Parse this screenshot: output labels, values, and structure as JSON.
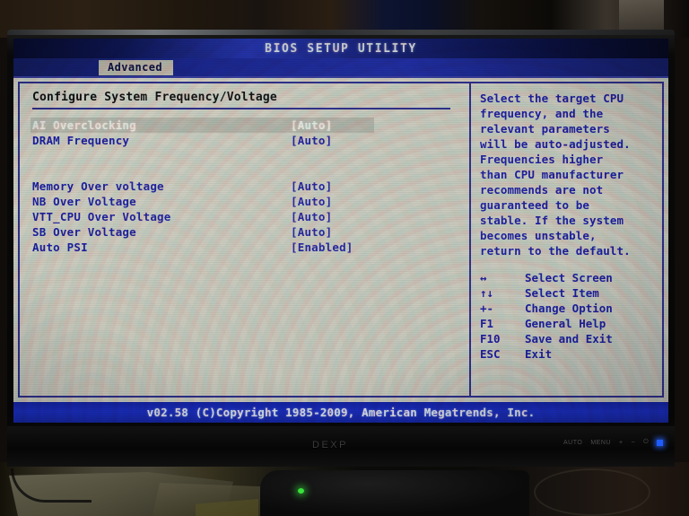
{
  "screen": {
    "title": "BIOS SETUP UTILITY",
    "active_tab": "Advanced",
    "section_title": "Configure System Frequency/Voltage",
    "options": [
      {
        "label": "AI Overclocking",
        "value": "[Auto]",
        "selected": true
      },
      {
        "label": "DRAM Frequency",
        "value": "[Auto]",
        "selected": false
      },
      {
        "label": "",
        "value": "",
        "selected": false
      },
      {
        "label": "",
        "value": "",
        "selected": false
      },
      {
        "label": "Memory Over voltage",
        "value": "[Auto]",
        "selected": false
      },
      {
        "label": "NB Over Voltage",
        "value": "[Auto]",
        "selected": false
      },
      {
        "label": "VTT_CPU Over Voltage",
        "value": "[Auto]",
        "selected": false
      },
      {
        "label": "SB Over Voltage",
        "value": "[Auto]",
        "selected": false
      },
      {
        "label": "Auto PSI",
        "value": "[Enabled]",
        "selected": false
      }
    ],
    "help": {
      "text": "Select the target CPU\nfrequency, and the\nrelevant parameters\nwill be auto-adjusted.\nFrequencies higher\nthan CPU manufacturer\nrecommends are not\nguaranteed to be\nstable. If the system\nbecomes unstable,\nreturn to the default.",
      "keys": [
        {
          "glyph": "↔",
          "desc": "Select Screen"
        },
        {
          "glyph": "↑↓",
          "desc": "Select Item"
        },
        {
          "glyph": "+-",
          "desc": "Change Option"
        },
        {
          "glyph": "F1",
          "desc": "General Help"
        },
        {
          "glyph": "F10",
          "desc": "Save and Exit"
        },
        {
          "glyph": "ESC",
          "desc": "Exit"
        }
      ]
    },
    "statusbar": "v02.58 (C)Copyright 1985-2009, American Megatrends, Inc."
  },
  "monitor": {
    "brand": "DEXP",
    "bezel_buttons": [
      "AUTO",
      "MENU",
      "+",
      "−",
      "⏻"
    ]
  },
  "colors": {
    "titlebar_blue": "#1a2580",
    "panel_border": "#2e2f8c",
    "option_text": "#1c1ea0",
    "selected_text": "#e9e9e2",
    "statusbar_blue": "#1a2ec4",
    "screen_bg": "#c9c9bd",
    "power_led": "#1f5cff",
    "desk_led": "#39e23c"
  }
}
